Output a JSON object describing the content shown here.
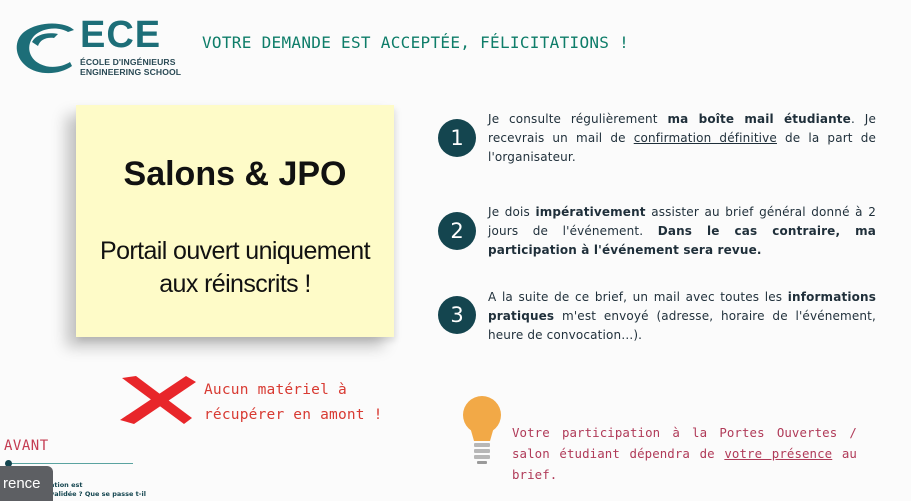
{
  "header": {
    "logo_text": "ECE",
    "logo_sub1": "ÉCOLE D'INGÉNIEURS",
    "logo_sub2": "ENGINEERING SCHOOL",
    "headline": "VOTRE DEMANDE EST ACCEPTÉE, FÉLICITATIONS !"
  },
  "note": {
    "title": "Salons & JPO",
    "body_line1": "Portail ouvert uniquement",
    "body_line2": "aux réinscrits !"
  },
  "steps": [
    {
      "number": "1",
      "parts": [
        {
          "text": "Je consulte régulièrement ",
          "style": "plain"
        },
        {
          "text": "ma boîte mail étudiante",
          "style": "bold"
        },
        {
          "text": ". Je recevrais un mail de ",
          "style": "plain"
        },
        {
          "text": "confirmation définitive",
          "style": "underline"
        },
        {
          "text": " de la part de l'organisateur.",
          "style": "plain"
        }
      ]
    },
    {
      "number": "2",
      "parts": [
        {
          "text": "Je dois ",
          "style": "plain"
        },
        {
          "text": "impérativement",
          "style": "bold"
        },
        {
          "text": " assister au brief général donné à 2 jours de l'événement. ",
          "style": "plain"
        },
        {
          "text": "Dans le cas contraire, ma participation à l'événement sera revue.",
          "style": "bold"
        }
      ]
    },
    {
      "number": "3",
      "parts": [
        {
          "text": "A la suite de ce brief, un mail avec toutes les ",
          "style": "plain"
        },
        {
          "text": "informations pratiques",
          "style": "bold"
        },
        {
          "text": " m'est envoyé (adresse, horaire de l'événement, heure de convocation…).",
          "style": "plain"
        }
      ]
    }
  ],
  "warning": {
    "line1": "Aucun matériel à",
    "line2": "récupérer en amont !"
  },
  "bulb_note": {
    "parts": [
      {
        "text": "Votre participation à la Portes Ouvertes / salon étudiant dépendra de ",
        "style": "plain"
      },
      {
        "text": "votre présence",
        "style": "underline"
      },
      {
        "text": " au brief.",
        "style": "plain"
      }
    ]
  },
  "timeline": {
    "label": "AVANT",
    "mini_line1": "ation est",
    "mini_line2": "validée ? Que se passe t-il"
  },
  "overlay_button": {
    "label": "rence"
  },
  "colors": {
    "brand_teal": "#1d6e78",
    "headline_green": "#0e7d69",
    "step_circle": "#14454f",
    "note_yellow": "#fefbc8",
    "warning_red": "#d83a32",
    "bulb_text": "#b03a58",
    "bulb_orange": "#f2a947"
  },
  "icons": [
    "ece-logo-swoosh-icon",
    "red-cross-icon",
    "lightbulb-icon"
  ]
}
